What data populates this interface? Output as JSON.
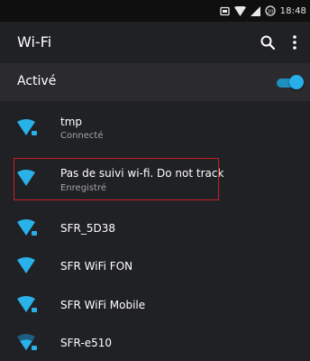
{
  "status_bar": {
    "time": "18:48",
    "badge": "20",
    "icons": [
      "cast-icon",
      "wifi-signal-icon",
      "cell-signal-icon",
      "data-saver-icon"
    ]
  },
  "appbar": {
    "title": "Wi-Fi",
    "actions": [
      "search-icon",
      "more-vert-icon"
    ]
  },
  "wifi_toggle": {
    "label": "Activé",
    "enabled": true,
    "accent": "#28aee8"
  },
  "networks": [
    {
      "name": "tmp",
      "status": "Connecté",
      "secured": true
    },
    {
      "name": "Pas de suivi wi-fi. Do not track",
      "status": "Enregistré",
      "secured": false
    },
    {
      "name": "SFR_5D38",
      "status": "",
      "secured": true
    },
    {
      "name": "SFR WiFi FON",
      "status": "",
      "secured": false
    },
    {
      "name": "SFR WiFi Mobile",
      "status": "",
      "secured": true
    },
    {
      "name": "SFR-e510",
      "status": "",
      "secured": true
    }
  ],
  "colors": {
    "background": "#202124",
    "toggle_row_background": "#2b2b2e",
    "icon_blue": "#29b1ea",
    "highlight_border": "#c62028"
  }
}
